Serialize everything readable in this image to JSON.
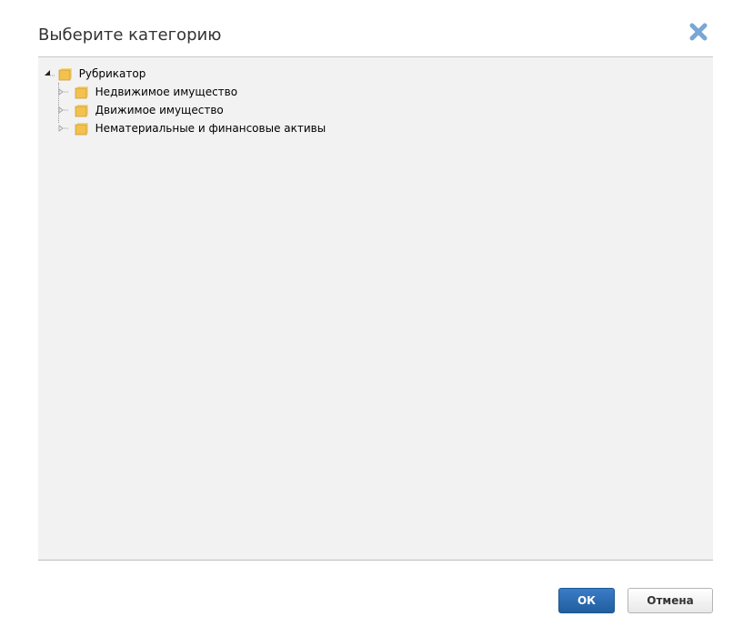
{
  "dialog": {
    "title": "Выберите категорию"
  },
  "tree": {
    "root": {
      "label": "Рубрикатор",
      "expanded": true
    },
    "children": [
      {
        "label": "Недвижимое имущество",
        "expanded": false
      },
      {
        "label": "Движимое имущество",
        "expanded": false
      },
      {
        "label": "Нематериальные и финансовые активы",
        "expanded": false
      }
    ]
  },
  "buttons": {
    "ok": "ОК",
    "cancel": "Отмена"
  },
  "colors": {
    "accent": "#2c6db3",
    "panel_bg": "#f2f2f2",
    "close_icon": "#7aa6d6",
    "folder": "#f2c14e"
  }
}
